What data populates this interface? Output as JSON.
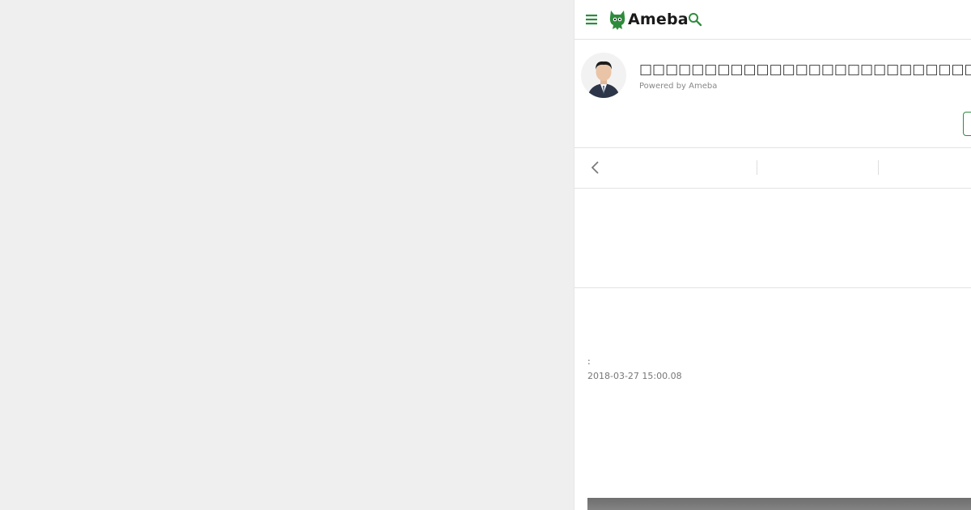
{
  "header": {
    "logo_text": "Ameba",
    "menu_icon": "hamburger-menu-icon",
    "search_icon": "search-icon",
    "accent_color": "#2d8c3c"
  },
  "blog": {
    "title": "□□□□□□□□□□□□□□□□□□□□□□□□□□□□□□□□□",
    "powered_by": "Powered by Ameba"
  },
  "navigation": {
    "prev_icon": "chevron-left-icon"
  },
  "article": {
    "meta_label": ":",
    "date": "2018-03-27 15:00.08"
  }
}
